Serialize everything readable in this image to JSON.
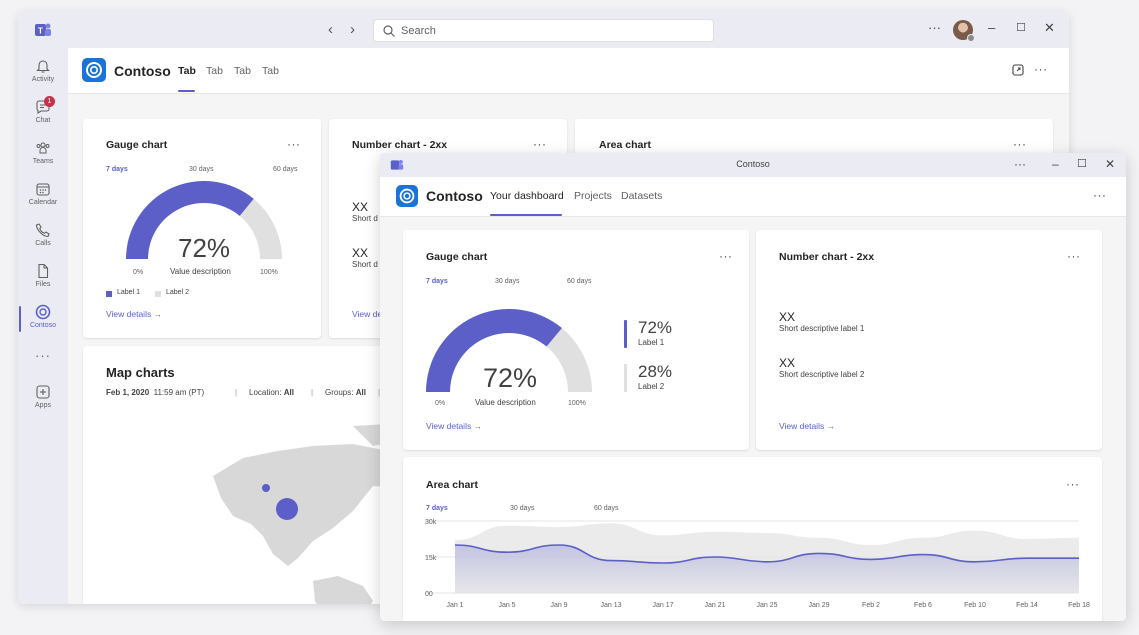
{
  "back": {
    "search_placeholder": "Search",
    "nav_back": "‹",
    "nav_forward": "›",
    "more": "···",
    "minimize": "–",
    "maximize": "☐",
    "close": "✕",
    "rail": [
      {
        "label": "Activity",
        "icon": "bell-icon"
      },
      {
        "label": "Chat",
        "icon": "chat-icon",
        "badge": "1"
      },
      {
        "label": "Teams",
        "icon": "teams-icon"
      },
      {
        "label": "Calendar",
        "icon": "calendar-icon"
      },
      {
        "label": "Calls",
        "icon": "phone-icon"
      },
      {
        "label": "Files",
        "icon": "file-icon"
      },
      {
        "label": "Contoso",
        "icon": "contoso-icon",
        "active": true
      },
      {
        "label": "",
        "icon": "more-icon"
      },
      {
        "label": "Apps",
        "icon": "plus-icon"
      }
    ],
    "app_name": "Contoso",
    "tabs": [
      "Tab",
      "Tab",
      "Tab",
      "Tab"
    ],
    "gauge": {
      "title": "Gauge chart",
      "periods": [
        "7 days",
        "30 days",
        "60 days"
      ],
      "value": "72%",
      "value_description": "Value description",
      "min": "0%",
      "max": "100%",
      "fraction": 0.72,
      "legend": [
        "Label 1",
        "Label 2"
      ],
      "link": "View details"
    },
    "number": {
      "title": "Number chart - 2xx",
      "v1": "XX",
      "l1": "Short d",
      "v2": "XX",
      "l2": "Short d",
      "link": "View de"
    },
    "area": {
      "title": "Area chart"
    },
    "map": {
      "title": "Map charts",
      "date": "Feb 1, 2020",
      "time": "11:59 am (PT)",
      "location_label": "Location:",
      "location_value": "All",
      "groups_label": "Groups:",
      "groups_value": "All",
      "sep": "|"
    }
  },
  "front": {
    "title": "Contoso",
    "more": "···",
    "minimize": "–",
    "maximize": "☐",
    "close": "✕",
    "app_name": "Contoso",
    "tabs": [
      "Your dashboard",
      "Projects",
      "Datasets"
    ],
    "gauge": {
      "title": "Gauge chart",
      "periods": [
        "7 days",
        "30 days",
        "60 days"
      ],
      "value": "72%",
      "value_description": "Value description",
      "min": "0%",
      "max": "100%",
      "fraction": 0.72,
      "items": [
        {
          "value": "72%",
          "label": "Label 1"
        },
        {
          "value": "28%",
          "label": "Label 2"
        }
      ],
      "link": "View details"
    },
    "number": {
      "title": "Number chart - 2xx",
      "items": [
        {
          "value": "XX",
          "label": "Short descriptive label 1"
        },
        {
          "value": "XX",
          "label": "Short descriptive label 2"
        }
      ],
      "link": "View details"
    },
    "area": {
      "title": "Area chart",
      "periods": [
        "7 days",
        "30 days",
        "60 days"
      ]
    }
  },
  "colors": {
    "accent": "#5b5fc7",
    "gauge_fill": "#5b5fc7",
    "gauge_track": "#e0e0e0",
    "brand": "#1a73d6"
  },
  "chart_data": {
    "type": "area",
    "x": [
      "Jan 1",
      "Jan 5",
      "Jan 9",
      "Jan 13",
      "Jan 17",
      "Jan 21",
      "Jan 25",
      "Jan 29",
      "Feb 2",
      "Feb 6",
      "Feb 10",
      "Feb 14",
      "Feb 18"
    ],
    "y_ticks": [
      "30k",
      "15k",
      "00"
    ],
    "ylim": [
      0,
      30000
    ],
    "series": [
      {
        "values": [
          22000,
          28000,
          27500,
          29000,
          24000,
          25500,
          25000,
          23000,
          20000,
          23000,
          26000,
          22500,
          23000
        ]
      },
      {
        "values": [
          20000,
          17000,
          20000,
          13500,
          12500,
          15000,
          13000,
          16500,
          14000,
          16000,
          13000,
          14500,
          14500
        ]
      }
    ],
    "colors": [
      "#e6e6e6",
      "#5b5fc7"
    ],
    "grid": true
  }
}
